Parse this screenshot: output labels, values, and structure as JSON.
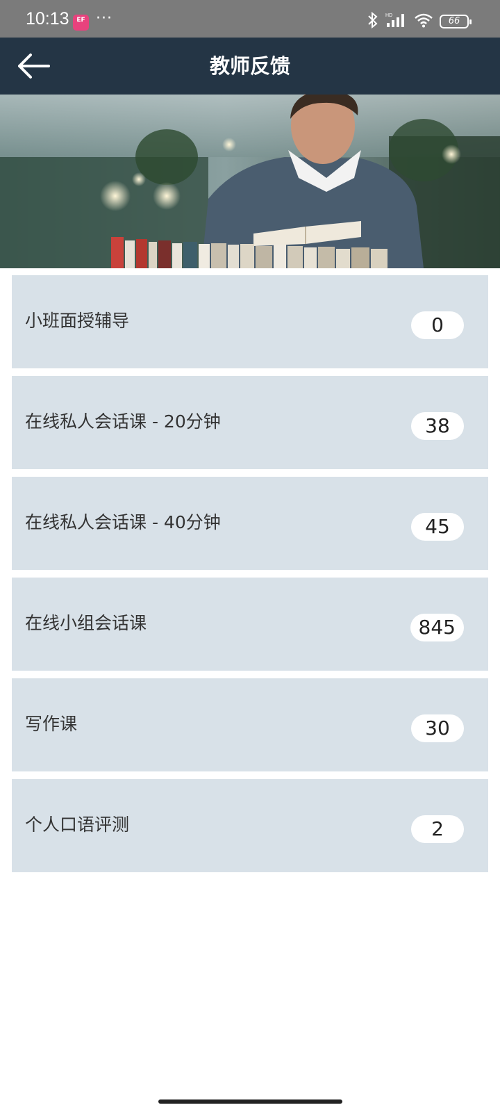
{
  "status_bar": {
    "time": "10:13",
    "app_icon_text": "EF",
    "more": "···",
    "battery": "66"
  },
  "header": {
    "title": "教师反馈",
    "back_icon": "arrow-left-icon"
  },
  "items": [
    {
      "label": "小班面授辅导",
      "count": "0"
    },
    {
      "label": "在线私人会话课 - 20分钟",
      "count": "38"
    },
    {
      "label": "在线私人会话课 - 40分钟",
      "count": "45"
    },
    {
      "label": "在线小组会话课",
      "count": "845"
    },
    {
      "label": "写作课",
      "count": "30"
    },
    {
      "label": "个人口语评测",
      "count": "2"
    }
  ],
  "colors": {
    "status_bar": "#7b7b7b",
    "header": "#243545",
    "item_bg": "#d8e1e8",
    "badge_bg": "#ffffff"
  }
}
